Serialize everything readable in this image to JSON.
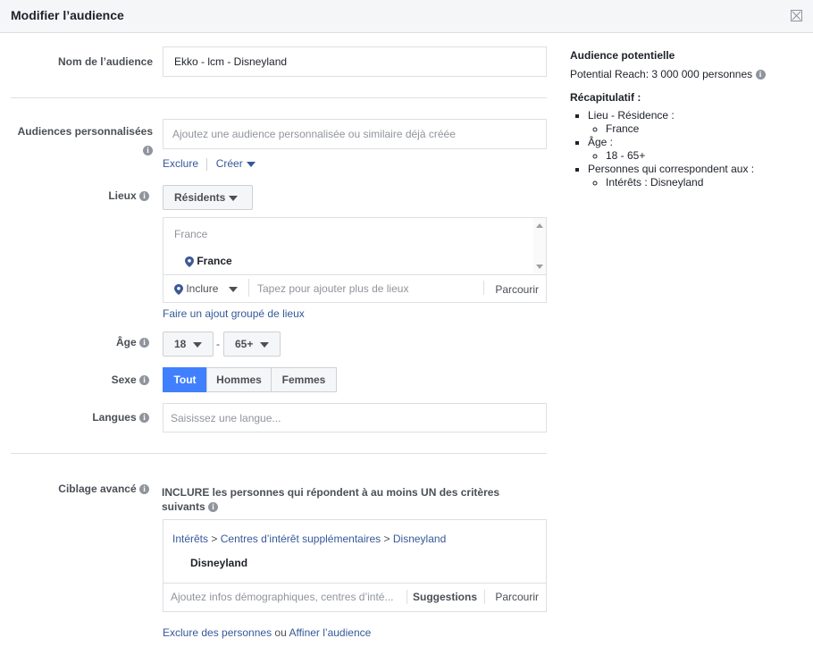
{
  "header": {
    "title": "Modifier l’audience"
  },
  "audience_name": {
    "label": "Nom de l’audience",
    "value": "Ekko - lcm - Disneyland"
  },
  "custom_audiences": {
    "label": "Audiences personnalisées",
    "placeholder": "Ajoutez une audience personnalisée ou similaire déjà créée",
    "exclude_label": "Exclure",
    "create_label": "Créer"
  },
  "locations": {
    "label": "Lieux",
    "type_label": "Résidents",
    "group_title": "France",
    "selected": "France",
    "include_label": "Inclure",
    "search_placeholder": "Tapez pour ajouter plus de lieux",
    "browse_label": "Parcourir",
    "bulk_link": "Faire un ajout groupé de lieux"
  },
  "age": {
    "label": "Âge",
    "min": "18",
    "separator": "-",
    "max": "65+"
  },
  "gender": {
    "label": "Sexe",
    "options": [
      "Tout",
      "Hommes",
      "Femmes"
    ],
    "selected": "Tout"
  },
  "languages": {
    "label": "Langues",
    "placeholder": "Saisissez une langue..."
  },
  "detailed_targeting": {
    "label": "Ciblage avancé",
    "description": "INCLURE les personnes qui répondent à au moins UN des critères suivants",
    "breadcrumb": [
      "Intérêts",
      "Centres d’intérêt supplémentaires",
      "Disneyland"
    ],
    "breadcrumb_sep": ">",
    "selected": "Disneyland",
    "search_placeholder": "Ajoutez infos démographiques, centres d’inté...",
    "suggestions_label": "Suggestions",
    "browse_label": "Parcourir",
    "exclude_link": "Exclure des personnes",
    "or_text": "ou",
    "narrow_link": "Affiner l’audience"
  },
  "summary": {
    "title": "Audience potentielle",
    "reach": "Potential Reach: 3 000 000 personnes",
    "recap_title": "Récapitulatif :",
    "items": [
      {
        "label": "Lieu - Résidence :",
        "sub": "France"
      },
      {
        "label": "Âge :",
        "sub": "18 - 65+"
      },
      {
        "label": "Personnes qui correspondent aux :",
        "sub": "Intérêts : Disneyland"
      }
    ]
  },
  "colors": {
    "accent": "#4080ff",
    "link": "#365899",
    "border": "#dddfe2"
  }
}
